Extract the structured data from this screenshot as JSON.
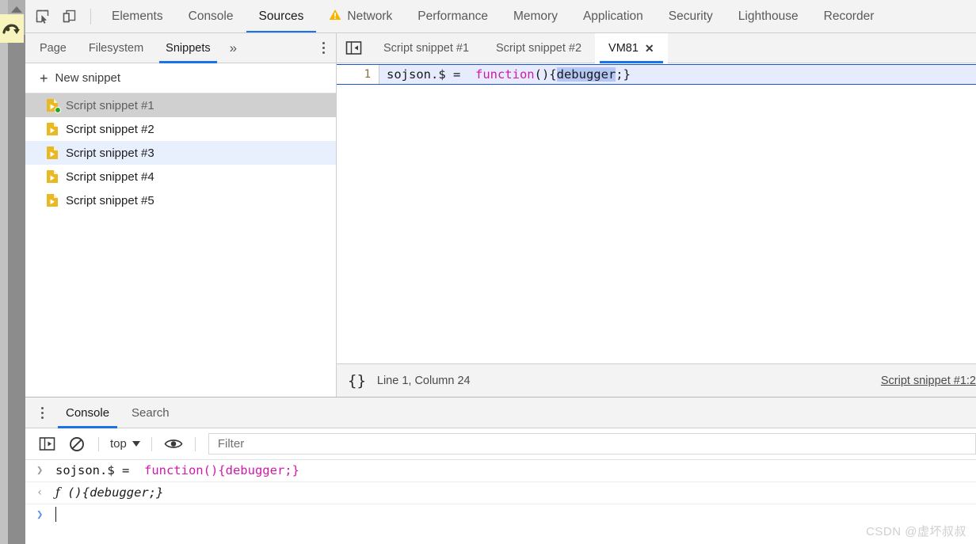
{
  "left_strip": {
    "favicon_name": "page-favicon"
  },
  "main_tabbar": {
    "inspect_icon": "inspect-element-icon",
    "device_icon": "device-toolbar-icon",
    "tabs": [
      {
        "label": "Elements",
        "active": false,
        "warn": false
      },
      {
        "label": "Console",
        "active": false,
        "warn": false
      },
      {
        "label": "Sources",
        "active": true,
        "warn": false
      },
      {
        "label": "Network",
        "active": false,
        "warn": true
      },
      {
        "label": "Performance",
        "active": false,
        "warn": false
      },
      {
        "label": "Memory",
        "active": false,
        "warn": false
      },
      {
        "label": "Application",
        "active": false,
        "warn": false
      },
      {
        "label": "Security",
        "active": false,
        "warn": false
      },
      {
        "label": "Lighthouse",
        "active": false,
        "warn": false
      },
      {
        "label": "Recorder",
        "active": false,
        "warn": false
      }
    ]
  },
  "nav_pane": {
    "tabs": [
      {
        "label": "Page",
        "active": false
      },
      {
        "label": "Filesystem",
        "active": false
      },
      {
        "label": "Snippets",
        "active": true
      }
    ],
    "more_label": "»",
    "new_snippet_label": "New snippet",
    "snippets": [
      {
        "label": "Script snippet #1",
        "state": "selected",
        "badge": true
      },
      {
        "label": "Script snippet #2",
        "state": "normal",
        "badge": false
      },
      {
        "label": "Script snippet #3",
        "state": "hover",
        "badge": false
      },
      {
        "label": "Script snippet #4",
        "state": "normal",
        "badge": false
      },
      {
        "label": "Script snippet #5",
        "state": "normal",
        "badge": false
      }
    ]
  },
  "editor": {
    "panel_toggle_icon": "show-navigator-icon",
    "tabs": [
      {
        "label": "Script snippet #1",
        "active": false,
        "closable": false
      },
      {
        "label": "Script snippet #2",
        "active": false,
        "closable": false
      },
      {
        "label": "VM81",
        "active": true,
        "closable": true,
        "close_label": "✕"
      }
    ],
    "line_number": "1",
    "code": {
      "prefix": "sojson.$ =  ",
      "keyword": "function",
      "after_keyword": "(){",
      "selected": "debugger",
      "suffix": ";}"
    },
    "status": {
      "format_icon": "pretty-print-icon",
      "format_glyph": "{}",
      "cursor_position": "Line 1, Column 24",
      "source_link": "Script snippet #1:2"
    }
  },
  "drawer": {
    "menu_icon": "drawer-menu-icon",
    "tabs": [
      {
        "label": "Console",
        "active": true
      },
      {
        "label": "Search",
        "active": false
      }
    ],
    "toolbar": {
      "sidebar_toggle_icon": "console-sidebar-icon",
      "clear_icon": "clear-console-icon",
      "context_value": "top",
      "eye_icon": "live-expression-icon",
      "filter_placeholder": "Filter"
    },
    "messages": [
      {
        "kind": "input",
        "marker": "❯",
        "prefix": "sojson.$ =  ",
        "keyword": "function",
        "rest": "(){debugger;}"
      },
      {
        "kind": "result",
        "marker": "‹",
        "glyph": "ƒ",
        "text": " (){debugger;}"
      },
      {
        "kind": "prompt",
        "marker": "❯",
        "text": ""
      }
    ]
  },
  "watermark": "CSDN @虚坏叔叔",
  "colors": {
    "accent": "#1a73e8",
    "selection": "#b5c7f5",
    "keyword": "#d119a6",
    "active_line": "#e6ecfd",
    "snippet_icon": "#e8b923",
    "badge": "#28a428",
    "warning": "#f5b400"
  }
}
